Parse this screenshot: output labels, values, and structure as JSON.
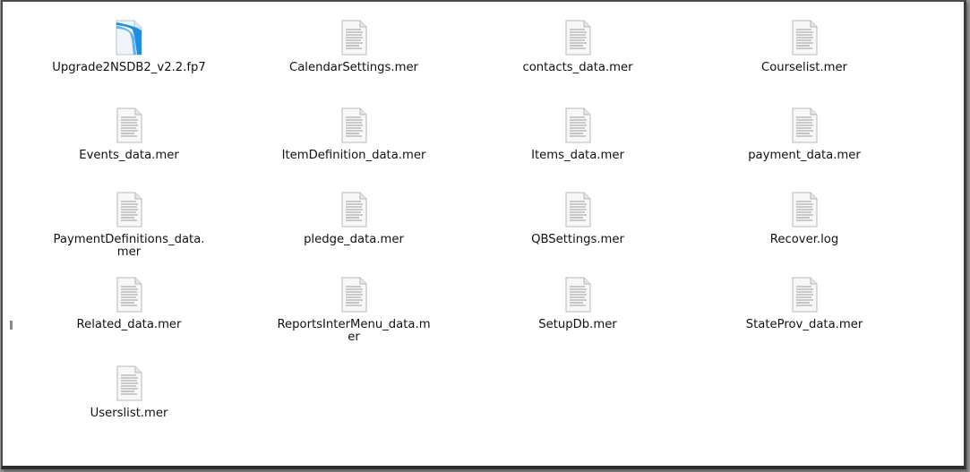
{
  "window": {
    "files": [
      {
        "name": "Upgrade2NSDB2_v2.2.fp7",
        "icon": "filemaker-database-icon"
      },
      {
        "name": "CalendarSettings.mer",
        "icon": "text-document-icon"
      },
      {
        "name": "contacts_data.mer",
        "icon": "text-document-icon"
      },
      {
        "name": "Courselist.mer",
        "icon": "text-document-icon"
      },
      {
        "name": "Events_data.mer",
        "icon": "text-document-icon"
      },
      {
        "name": "ItemDefinition_data.mer",
        "icon": "text-document-icon"
      },
      {
        "name": "Items_data.mer",
        "icon": "text-document-icon"
      },
      {
        "name": "payment_data.mer",
        "icon": "text-document-icon"
      },
      {
        "name": "PaymentDefinitions_data.\nmer",
        "icon": "text-document-icon"
      },
      {
        "name": "pledge_data.mer",
        "icon": "text-document-icon"
      },
      {
        "name": "QBSettings.mer",
        "icon": "text-document-icon"
      },
      {
        "name": "Recover.log",
        "icon": "text-document-icon"
      },
      {
        "name": "Related_data.mer",
        "icon": "text-document-icon"
      },
      {
        "name": "ReportsInterMenu_data.m\ner",
        "icon": "text-document-icon"
      },
      {
        "name": "SetupDb.mer",
        "icon": "text-document-icon"
      },
      {
        "name": "StateProv_data.mer",
        "icon": "text-document-icon"
      },
      {
        "name": "Userslist.mer",
        "icon": "text-document-icon"
      }
    ]
  },
  "colors": {
    "window_bg": "#ffffff",
    "desktop_bg": "#9a9a9a",
    "fp7_accent": "#1e8fe0"
  }
}
